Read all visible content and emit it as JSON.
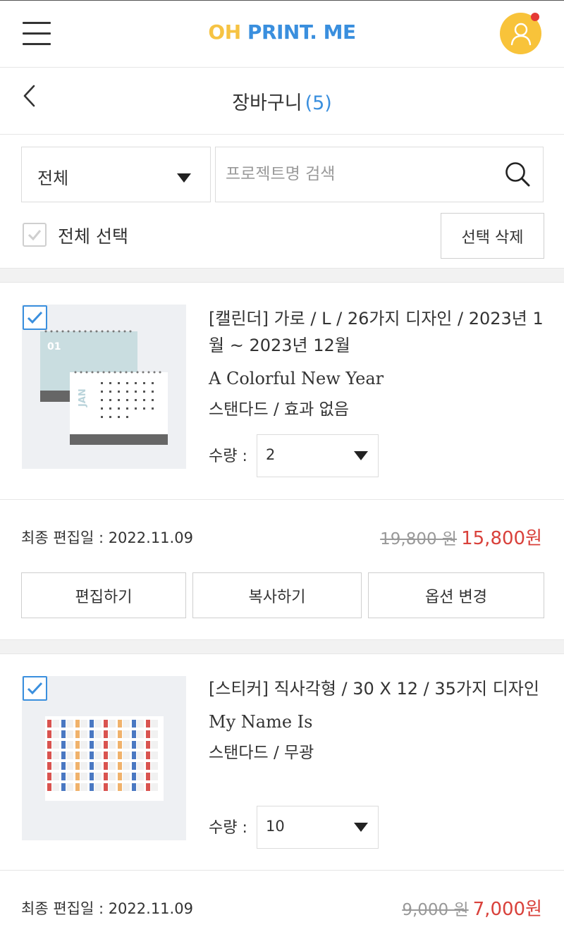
{
  "header": {
    "logo_part1": "OH",
    "logo_part2": "PRINT. ME",
    "menu_icon": "hamburger-icon",
    "profile_icon": "user-icon",
    "notification_color": "#e53935",
    "brand_yellow": "#f6c343",
    "brand_blue": "#3a8fde"
  },
  "titlebar": {
    "title": "장바구니",
    "count": "(5)"
  },
  "filter": {
    "category_selected": "전체",
    "search_placeholder": "프로젝트명 검색",
    "select_all_label": "전체 선택",
    "delete_selected_label": "선택 삭제"
  },
  "items": [
    {
      "title": "[캘린더] 가로 / L / 26가지 디자인 / 2023년 1월 ~ 2023년 12월",
      "project_name": "A Colorful New Year",
      "options": "스탠다드 / 효과 없음",
      "quantity_label": "수량 :",
      "quantity": "2",
      "checked": true,
      "last_edited": "최종 편집일 : 2022.11.09",
      "original_price": "19,800 원",
      "final_price": "15,800원",
      "thumb_month_num": "01",
      "thumb_month": "JAN",
      "buttons": {
        "edit": "편집하기",
        "copy": "복사하기",
        "change_options": "옵션 변경"
      }
    },
    {
      "title": "[스티커] 직사각형 / 30 X 12 / 35가지 디자인",
      "project_name": "My Name Is",
      "options": "스탠다드 / 무광",
      "quantity_label": "수량 :",
      "quantity": "10",
      "checked": true,
      "last_edited": "최종 편집일 : 2022.11.09",
      "original_price": "9,000 원",
      "final_price": "7,000원"
    }
  ]
}
